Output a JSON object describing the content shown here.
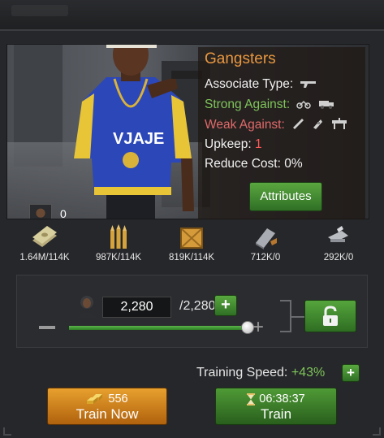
{
  "unit": {
    "name": "Gangsters",
    "associate_type_label": "Associate Type:",
    "strong_against_label": "Strong Against:",
    "weak_against_label": "Weak Against:",
    "upkeep_label": "Upkeep:",
    "upkeep_value": "1",
    "reduce_cost_label": "Reduce Cost:",
    "reduce_cost_value": "0%",
    "owned_count": "0",
    "attributes_label": "Attributes",
    "associate_type_icon": "gun-icon",
    "strong_against_icons": [
      "bike-icon",
      "truck-icon"
    ],
    "weak_against_icons": [
      "sword-icon",
      "knife-icon",
      "barrier-icon"
    ]
  },
  "resources": [
    {
      "icon": "cash-icon",
      "value": "1.64M/114K"
    },
    {
      "icon": "ammo-icon",
      "value": "987K/114K"
    },
    {
      "icon": "crate-icon",
      "value": "819K/114K"
    },
    {
      "icon": "metal-icon",
      "value": "712K/0"
    },
    {
      "icon": "parts-icon",
      "value": "292K/0"
    }
  ],
  "training": {
    "quantity": "2,280",
    "max": "/2,280",
    "slider_fraction": 1.0
  },
  "speed": {
    "label": "Training Speed:",
    "value": "+43%"
  },
  "buttons": {
    "train_now_cost": "556",
    "train_now_label": "Train Now",
    "train_time": "06:38:37",
    "train_label": "Train"
  },
  "colors": {
    "accent_orange": "#e9973f",
    "strong_green": "#7ec45a",
    "weak_red": "#e06a6a",
    "button_green": "#4f9a36",
    "button_orange": "#e8a02e"
  }
}
